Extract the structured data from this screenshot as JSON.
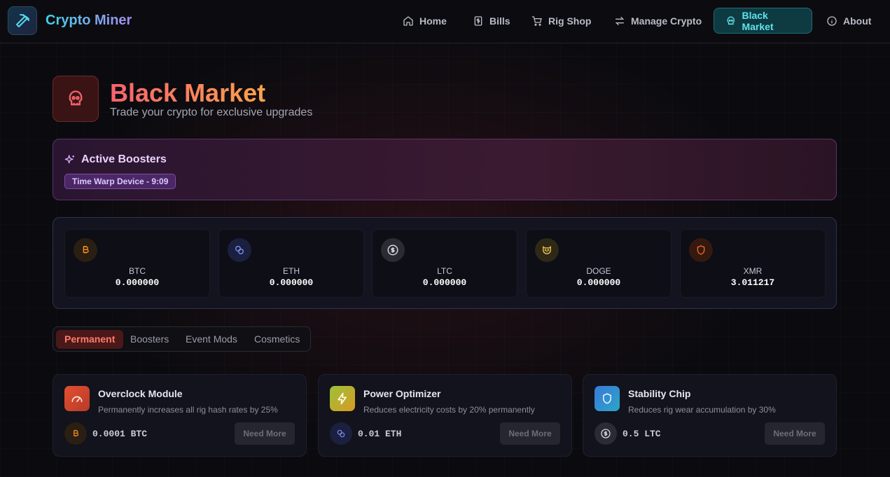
{
  "app": {
    "name": "Crypto Miner"
  },
  "nav": [
    {
      "label": "Home",
      "icon": "home-icon"
    },
    {
      "label": "Bills",
      "icon": "receipt-dollar-icon"
    },
    {
      "label": "Rig Shop",
      "icon": "cart-icon"
    },
    {
      "label": "Manage Crypto",
      "icon": "swap-arrows-icon"
    },
    {
      "label": "Black Market",
      "icon": "skull-icon",
      "active": true
    },
    {
      "label": "About",
      "icon": "info-icon"
    }
  ],
  "header": {
    "title": "Black Market",
    "subtitle": "Trade your crypto for exclusive upgrades",
    "icon": "skull-icon"
  },
  "boosters": {
    "title": "Active Boosters",
    "icon": "sparkles-icon",
    "items": [
      "Time Warp Device - 9:09"
    ]
  },
  "wallet": [
    {
      "symbol": "BTC",
      "value": "0.000000",
      "icon": "bitcoin-icon",
      "color": "#f7931a"
    },
    {
      "symbol": "ETH",
      "value": "0.000000",
      "icon": "eth-link-icon",
      "color": "#627eea"
    },
    {
      "symbol": "LTC",
      "value": "0.000000",
      "icon": "dollar-circle-icon",
      "color": "#d1d5db"
    },
    {
      "symbol": "DOGE",
      "value": "0.000000",
      "icon": "dog-icon",
      "color": "#e0b94a"
    },
    {
      "symbol": "XMR",
      "value": "3.011217",
      "icon": "shield-icon",
      "color": "#f26822"
    }
  ],
  "tabs": [
    {
      "label": "Permanent",
      "active": true
    },
    {
      "label": "Boosters"
    },
    {
      "label": "Event Mods"
    },
    {
      "label": "Cosmetics"
    }
  ],
  "items": [
    {
      "title": "Overclock Module",
      "desc": "Permanently increases all rig hash rates by 25%",
      "price": "0.0001 BTC",
      "button": "Need More",
      "icon": "gauge-icon",
      "price_icon": "bitcoin-icon"
    },
    {
      "title": "Power Optimizer",
      "desc": "Reduces electricity costs by 20% permanently",
      "price": "0.01 ETH",
      "button": "Need More",
      "icon": "lightning-icon",
      "price_icon": "eth-link-icon"
    },
    {
      "title": "Stability Chip",
      "desc": "Reduces rig wear accumulation by 30%",
      "price": "0.5 LTC",
      "button": "Need More",
      "icon": "shield-icon",
      "price_icon": "dollar-circle-icon"
    }
  ]
}
